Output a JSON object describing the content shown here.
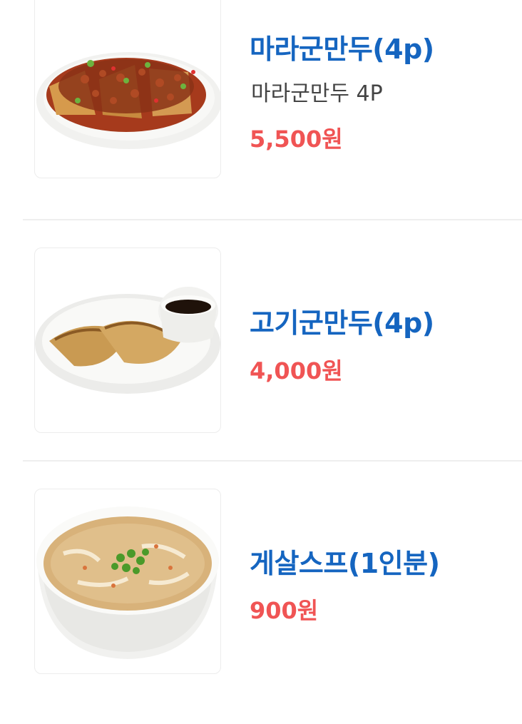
{
  "menu": {
    "items": [
      {
        "name": "마라군만두(4p)",
        "description": "마라군만두 4P",
        "price": "5,500원",
        "image": "mala-fried-dumplings-photo"
      },
      {
        "name": "고기군만두(4p)",
        "price": "4,000원",
        "image": "meat-fried-dumplings-photo"
      },
      {
        "name": "게살스프(1인분)",
        "price": "900원",
        "image": "crab-meat-soup-photo"
      }
    ]
  },
  "colors": {
    "name": "#1565c0",
    "price": "#f05454",
    "description": "#444444",
    "divider": "#eeeeee"
  }
}
